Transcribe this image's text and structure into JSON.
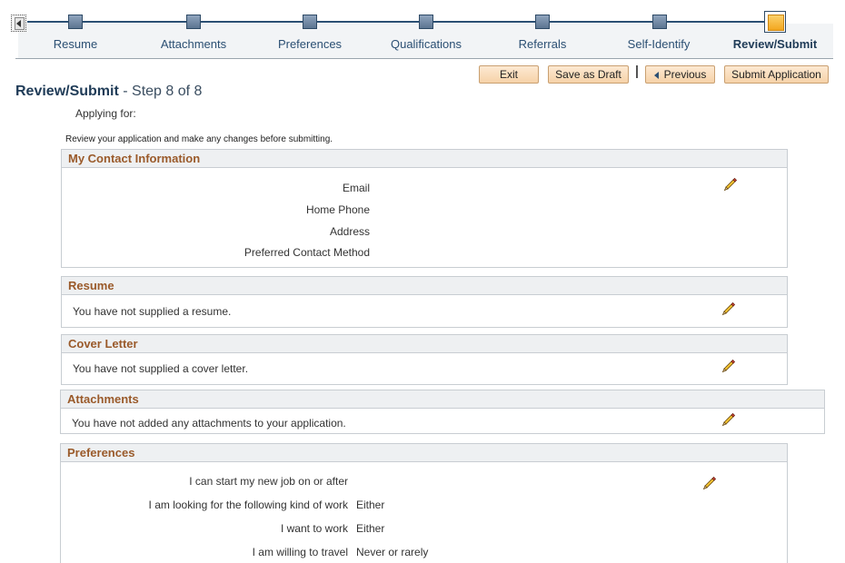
{
  "train": {
    "steps": [
      {
        "label": "Resume"
      },
      {
        "label": "Attachments"
      },
      {
        "label": "Preferences"
      },
      {
        "label": "Qualifications"
      },
      {
        "label": "Referrals"
      },
      {
        "label": "Self-Identify"
      },
      {
        "label": "Review/Submit"
      }
    ],
    "current_index": 6
  },
  "toolbar": {
    "exit_label": "Exit",
    "save_draft_label": "Save as Draft",
    "previous_label": "Previous",
    "submit_label": "Submit Application"
  },
  "page": {
    "title": "Review/Submit",
    "step_text": "- Step 8 of 8",
    "applying_for_label": "Applying for:",
    "instructions": "Review your application and make any changes before submitting."
  },
  "contact": {
    "title": "My Contact Information",
    "fields": [
      {
        "label": "Email"
      },
      {
        "label": "Home Phone"
      },
      {
        "label": "Address"
      },
      {
        "label": "Preferred Contact Method"
      }
    ]
  },
  "resume": {
    "title": "Resume",
    "message": "You have not supplied a resume."
  },
  "cover_letter": {
    "title": "Cover Letter",
    "message": "You have not supplied a cover letter."
  },
  "attachments": {
    "title": "Attachments",
    "message": "You have not added any attachments to your application."
  },
  "preferences": {
    "title": "Preferences",
    "fields": [
      {
        "label": "I can start my new job on or after",
        "value": ""
      },
      {
        "label": "I am looking for the following kind of work",
        "value": "Either"
      },
      {
        "label": "I want to work",
        "value": "Either"
      },
      {
        "label": "I am willing to travel",
        "value": "Never or rarely"
      }
    ]
  },
  "icons": {
    "edit": "pencil-icon",
    "back": "train-back-icon"
  }
}
